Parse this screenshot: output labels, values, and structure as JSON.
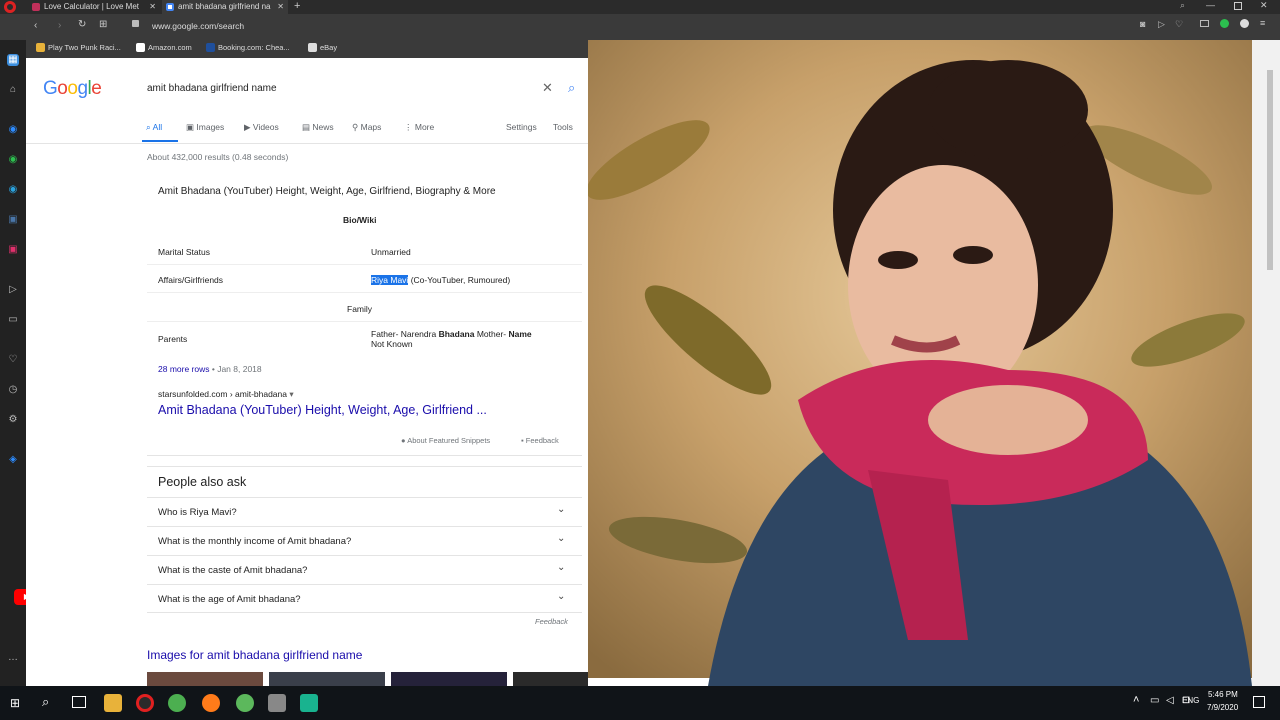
{
  "browser": {
    "tabs": [
      {
        "title": "Love Calculator | Love Met"
      },
      {
        "title": "amit bhadana girlfriend na"
      }
    ],
    "address": "www.google.com/search",
    "bookmarks": [
      {
        "label": "Play Two Punk Raci..."
      },
      {
        "label": "Amazon.com"
      },
      {
        "label": "Booking.com: Chea..."
      },
      {
        "label": "eBay"
      }
    ]
  },
  "google": {
    "logo": "Google",
    "query": "amit bhadana girlfriend name",
    "tabs": [
      {
        "label": "All"
      },
      {
        "label": "Images"
      },
      {
        "label": "Videos"
      },
      {
        "label": "News"
      },
      {
        "label": "Maps"
      },
      {
        "label": "More"
      }
    ],
    "settings": "Settings",
    "tools": "Tools",
    "stats": "About 432,000 results (0.48 seconds)",
    "snippet": {
      "title": "Amit Bhadana (YouTuber) Height, Weight, Age, Girlfriend, Biography & More",
      "section1": "Bio/Wiki",
      "rows": [
        {
          "label": "Marital Status",
          "value": "Unmarried"
        },
        {
          "label": "Affairs/Girlfriends",
          "highlight": "Riya Mavi",
          "value": "(Co-YouTuber, Rumoured)"
        }
      ],
      "section2": "Family",
      "parents_label": "Parents",
      "parents_value_1a": "Father- Narendra ",
      "parents_value_1b": "Bhadana",
      "parents_value_1c": " Mother- ",
      "parents_value_1d": "Name",
      "parents_value_2": "Not Known",
      "more_rows": "28 more rows",
      "date": " • Jan 8, 2018",
      "source": "starsunfolded.com › amit-bhadana",
      "link": "Amit Bhadana (YouTuber) Height, Weight, Age, Girlfriend ...",
      "about": "About Featured Snippets",
      "feedback": "Feedback"
    },
    "paa": {
      "title": "People also ask",
      "questions": [
        "Who is Riya Mavi?",
        "What is the monthly income of Amit bhadana?",
        "What is the caste of Amit bhadana?",
        "What is the age of Amit bhadana?"
      ],
      "feedback": "Feedback"
    },
    "images_heading": "Images for amit bhadana girlfriend name"
  },
  "taskbar": {
    "lang": "ENG",
    "time": "5:46 PM",
    "date": "7/9/2020"
  }
}
